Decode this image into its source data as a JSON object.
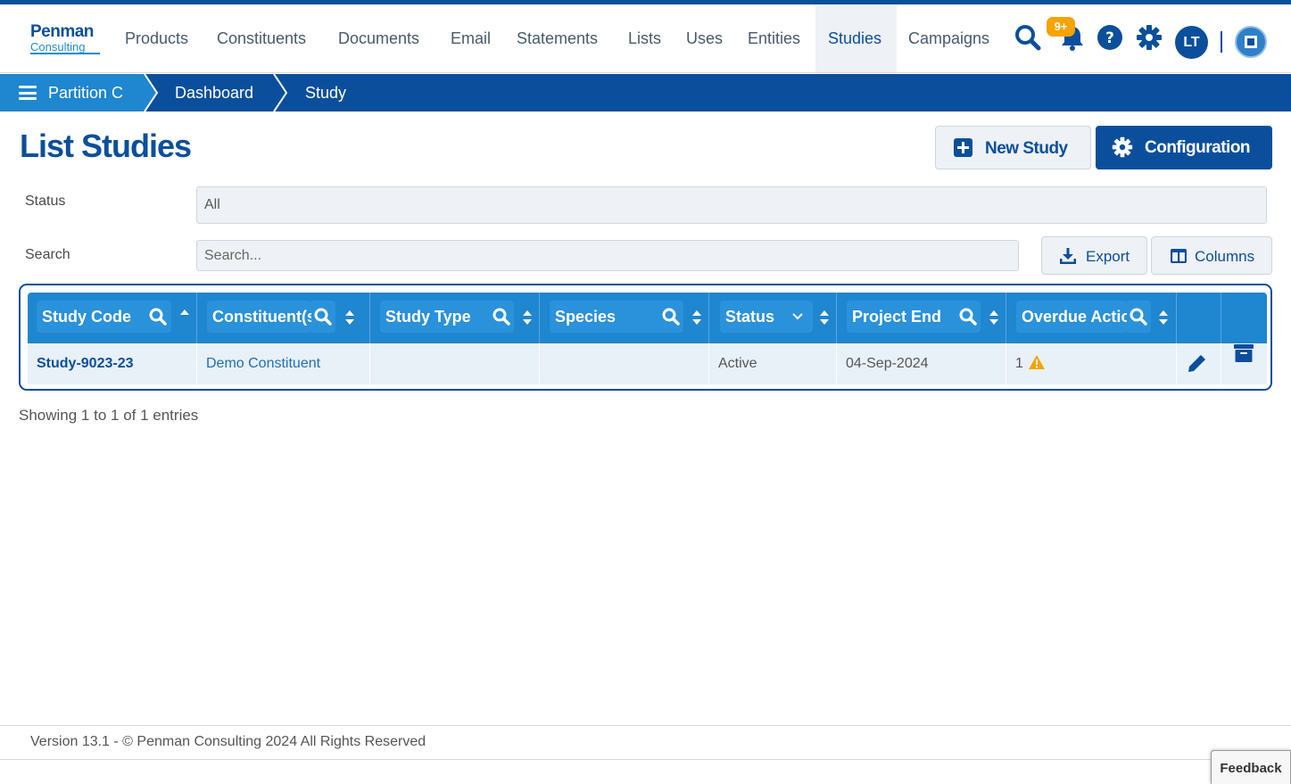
{
  "brand": {
    "line1": "Penman",
    "line2": "Consulting"
  },
  "nav": {
    "items": [
      {
        "label": "Products"
      },
      {
        "label": "Constituents"
      },
      {
        "label": "Documents"
      },
      {
        "label": "Email"
      },
      {
        "label": "Statements"
      },
      {
        "label": "Lists"
      },
      {
        "label": "Uses"
      },
      {
        "label": "Entities"
      },
      {
        "label": "Studies",
        "active": true
      },
      {
        "label": "Campaigns"
      }
    ],
    "notification_badge": "9+",
    "user_initials": "LT",
    "icons": [
      "search-icon",
      "bell-icon",
      "help-icon",
      "gear-icon",
      "avatar",
      "app-switcher-icon"
    ]
  },
  "breadcrumb": {
    "items": [
      "Partition C",
      "Dashboard",
      "Study"
    ]
  },
  "page": {
    "title": "List Studies",
    "new_button": "New Study",
    "config_button": "Configuration"
  },
  "filters": {
    "status_label": "Status",
    "status_value": "All",
    "search_label": "Search",
    "search_placeholder": "Search...",
    "export_label": "Export",
    "columns_label": "Columns"
  },
  "table": {
    "columns": [
      "Study Code",
      "Constituent(s)",
      "Study Type",
      "Species",
      "Status",
      "Project End",
      "Overdue Actions"
    ],
    "rows": [
      {
        "study_code": "Study-9023-23",
        "constituent": "Demo Constituent",
        "study_type": "",
        "species": "",
        "status": "Active",
        "project_end": "04-Sep-2024",
        "overdue": "1"
      }
    ]
  },
  "showing": "Showing 1 to 1 of 1 entries",
  "footer": {
    "text": "Version 13.1 - © Penman Consulting 2024 All Rights Reserved",
    "feedback": "Feedback"
  },
  "colors": {
    "primary": "#0b4f9c",
    "accent": "#1f86d0",
    "badge": "#f5a300",
    "warning": "#f5a300"
  }
}
